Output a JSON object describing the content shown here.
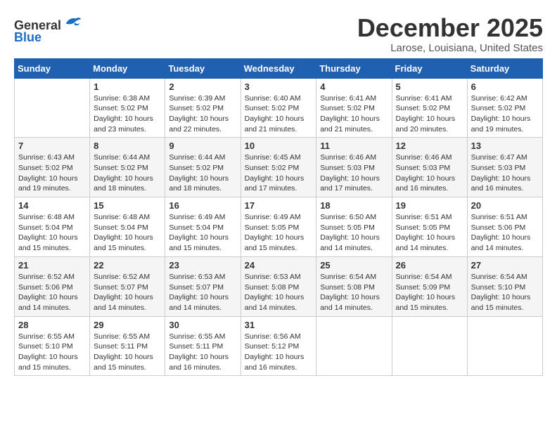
{
  "logo": {
    "line1": "General",
    "line2": "Blue"
  },
  "title": "December 2025",
  "location": "Larose, Louisiana, United States",
  "days_of_week": [
    "Sunday",
    "Monday",
    "Tuesday",
    "Wednesday",
    "Thursday",
    "Friday",
    "Saturday"
  ],
  "weeks": [
    [
      {
        "day": "",
        "sunrise": "",
        "sunset": "",
        "daylight": ""
      },
      {
        "day": "1",
        "sunrise": "Sunrise: 6:38 AM",
        "sunset": "Sunset: 5:02 PM",
        "daylight": "Daylight: 10 hours and 23 minutes."
      },
      {
        "day": "2",
        "sunrise": "Sunrise: 6:39 AM",
        "sunset": "Sunset: 5:02 PM",
        "daylight": "Daylight: 10 hours and 22 minutes."
      },
      {
        "day": "3",
        "sunrise": "Sunrise: 6:40 AM",
        "sunset": "Sunset: 5:02 PM",
        "daylight": "Daylight: 10 hours and 21 minutes."
      },
      {
        "day": "4",
        "sunrise": "Sunrise: 6:41 AM",
        "sunset": "Sunset: 5:02 PM",
        "daylight": "Daylight: 10 hours and 21 minutes."
      },
      {
        "day": "5",
        "sunrise": "Sunrise: 6:41 AM",
        "sunset": "Sunset: 5:02 PM",
        "daylight": "Daylight: 10 hours and 20 minutes."
      },
      {
        "day": "6",
        "sunrise": "Sunrise: 6:42 AM",
        "sunset": "Sunset: 5:02 PM",
        "daylight": "Daylight: 10 hours and 19 minutes."
      }
    ],
    [
      {
        "day": "7",
        "sunrise": "Sunrise: 6:43 AM",
        "sunset": "Sunset: 5:02 PM",
        "daylight": "Daylight: 10 hours and 19 minutes."
      },
      {
        "day": "8",
        "sunrise": "Sunrise: 6:44 AM",
        "sunset": "Sunset: 5:02 PM",
        "daylight": "Daylight: 10 hours and 18 minutes."
      },
      {
        "day": "9",
        "sunrise": "Sunrise: 6:44 AM",
        "sunset": "Sunset: 5:02 PM",
        "daylight": "Daylight: 10 hours and 18 minutes."
      },
      {
        "day": "10",
        "sunrise": "Sunrise: 6:45 AM",
        "sunset": "Sunset: 5:02 PM",
        "daylight": "Daylight: 10 hours and 17 minutes."
      },
      {
        "day": "11",
        "sunrise": "Sunrise: 6:46 AM",
        "sunset": "Sunset: 5:03 PM",
        "daylight": "Daylight: 10 hours and 17 minutes."
      },
      {
        "day": "12",
        "sunrise": "Sunrise: 6:46 AM",
        "sunset": "Sunset: 5:03 PM",
        "daylight": "Daylight: 10 hours and 16 minutes."
      },
      {
        "day": "13",
        "sunrise": "Sunrise: 6:47 AM",
        "sunset": "Sunset: 5:03 PM",
        "daylight": "Daylight: 10 hours and 16 minutes."
      }
    ],
    [
      {
        "day": "14",
        "sunrise": "Sunrise: 6:48 AM",
        "sunset": "Sunset: 5:04 PM",
        "daylight": "Daylight: 10 hours and 15 minutes."
      },
      {
        "day": "15",
        "sunrise": "Sunrise: 6:48 AM",
        "sunset": "Sunset: 5:04 PM",
        "daylight": "Daylight: 10 hours and 15 minutes."
      },
      {
        "day": "16",
        "sunrise": "Sunrise: 6:49 AM",
        "sunset": "Sunset: 5:04 PM",
        "daylight": "Daylight: 10 hours and 15 minutes."
      },
      {
        "day": "17",
        "sunrise": "Sunrise: 6:49 AM",
        "sunset": "Sunset: 5:05 PM",
        "daylight": "Daylight: 10 hours and 15 minutes."
      },
      {
        "day": "18",
        "sunrise": "Sunrise: 6:50 AM",
        "sunset": "Sunset: 5:05 PM",
        "daylight": "Daylight: 10 hours and 14 minutes."
      },
      {
        "day": "19",
        "sunrise": "Sunrise: 6:51 AM",
        "sunset": "Sunset: 5:05 PM",
        "daylight": "Daylight: 10 hours and 14 minutes."
      },
      {
        "day": "20",
        "sunrise": "Sunrise: 6:51 AM",
        "sunset": "Sunset: 5:06 PM",
        "daylight": "Daylight: 10 hours and 14 minutes."
      }
    ],
    [
      {
        "day": "21",
        "sunrise": "Sunrise: 6:52 AM",
        "sunset": "Sunset: 5:06 PM",
        "daylight": "Daylight: 10 hours and 14 minutes."
      },
      {
        "day": "22",
        "sunrise": "Sunrise: 6:52 AM",
        "sunset": "Sunset: 5:07 PM",
        "daylight": "Daylight: 10 hours and 14 minutes."
      },
      {
        "day": "23",
        "sunrise": "Sunrise: 6:53 AM",
        "sunset": "Sunset: 5:07 PM",
        "daylight": "Daylight: 10 hours and 14 minutes."
      },
      {
        "day": "24",
        "sunrise": "Sunrise: 6:53 AM",
        "sunset": "Sunset: 5:08 PM",
        "daylight": "Daylight: 10 hours and 14 minutes."
      },
      {
        "day": "25",
        "sunrise": "Sunrise: 6:54 AM",
        "sunset": "Sunset: 5:08 PM",
        "daylight": "Daylight: 10 hours and 14 minutes."
      },
      {
        "day": "26",
        "sunrise": "Sunrise: 6:54 AM",
        "sunset": "Sunset: 5:09 PM",
        "daylight": "Daylight: 10 hours and 15 minutes."
      },
      {
        "day": "27",
        "sunrise": "Sunrise: 6:54 AM",
        "sunset": "Sunset: 5:10 PM",
        "daylight": "Daylight: 10 hours and 15 minutes."
      }
    ],
    [
      {
        "day": "28",
        "sunrise": "Sunrise: 6:55 AM",
        "sunset": "Sunset: 5:10 PM",
        "daylight": "Daylight: 10 hours and 15 minutes."
      },
      {
        "day": "29",
        "sunrise": "Sunrise: 6:55 AM",
        "sunset": "Sunset: 5:11 PM",
        "daylight": "Daylight: 10 hours and 15 minutes."
      },
      {
        "day": "30",
        "sunrise": "Sunrise: 6:55 AM",
        "sunset": "Sunset: 5:11 PM",
        "daylight": "Daylight: 10 hours and 16 minutes."
      },
      {
        "day": "31",
        "sunrise": "Sunrise: 6:56 AM",
        "sunset": "Sunset: 5:12 PM",
        "daylight": "Daylight: 10 hours and 16 minutes."
      },
      {
        "day": "",
        "sunrise": "",
        "sunset": "",
        "daylight": ""
      },
      {
        "day": "",
        "sunrise": "",
        "sunset": "",
        "daylight": ""
      },
      {
        "day": "",
        "sunrise": "",
        "sunset": "",
        "daylight": ""
      }
    ]
  ]
}
